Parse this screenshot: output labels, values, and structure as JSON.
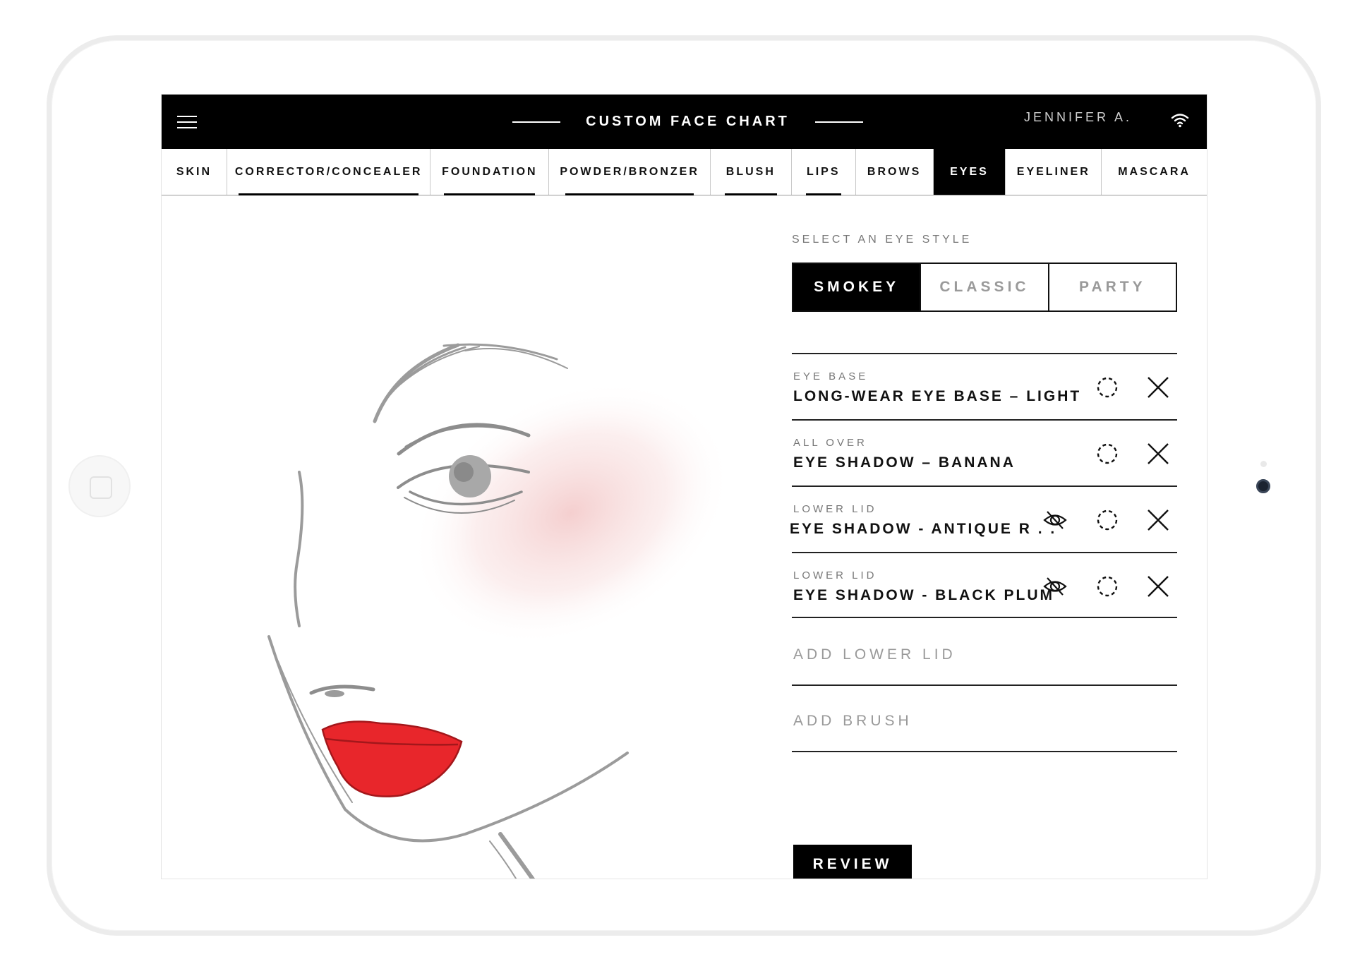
{
  "header": {
    "title": "CUSTOM FACE CHART",
    "user_name": "JENNIFER A."
  },
  "tabs": [
    {
      "label": "SKIN",
      "active": false
    },
    {
      "label": "CORRECTOR/CONCEALER",
      "active": false
    },
    {
      "label": "FOUNDATION",
      "active": false
    },
    {
      "label": "POWDER/BRONZER",
      "active": false
    },
    {
      "label": "BLUSH",
      "active": false
    },
    {
      "label": "LIPS",
      "active": false
    },
    {
      "label": "BROWS",
      "active": false
    },
    {
      "label": "EYES",
      "active": true
    },
    {
      "label": "EYELINER",
      "active": false
    },
    {
      "label": "MASCARA",
      "active": false
    }
  ],
  "eye_style": {
    "label": "SELECT AN EYE STYLE",
    "options": [
      "SMOKEY",
      "CLASSIC",
      "PARTY"
    ],
    "selected": "SMOKEY"
  },
  "products": [
    {
      "category": "EYE BASE",
      "name": "LONG-WEAR EYE BASE – LIGHT",
      "hidden_icon": false
    },
    {
      "category": "ALL OVER",
      "name": "EYE SHADOW – BANANA",
      "hidden_icon": false
    },
    {
      "category": "LOWER LID",
      "name": "EYE SHADOW - ANTIQUE R . .",
      "hidden_icon": true
    },
    {
      "category": "LOWER LID",
      "name": "EYE SHADOW - BLACK PLUM",
      "hidden_icon": true
    }
  ],
  "actions": {
    "add_lower_lid": "ADD LOWER LID",
    "add_brush": "ADD BRUSH",
    "review": "REVIEW"
  },
  "colors": {
    "lip": "#e8262b",
    "blush": "#f3c9c9",
    "sketch": "#9b9b9b"
  }
}
